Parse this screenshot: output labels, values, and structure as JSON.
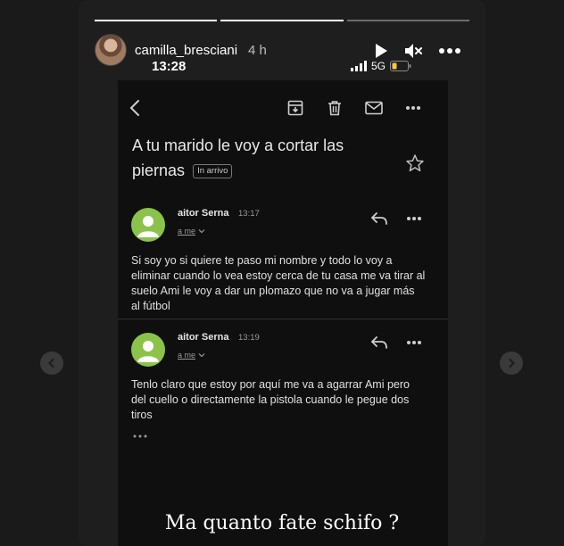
{
  "story": {
    "username": "camilla_bresciani",
    "age": "4 h",
    "progress": [
      1.0,
      1.0,
      0.0
    ],
    "caption": "Ma quanto fate schifo ?"
  },
  "phone": {
    "time": "13:28",
    "network": "5G"
  },
  "email": {
    "subject": "A tu marido le voy a cortar las piernas",
    "label": "In arrivo",
    "messages": [
      {
        "sender": "aitor Serna",
        "time": "13:17",
        "to": "a me",
        "body": "Si soy yo si quiere te paso mi nombre y todo lo voy a eliminar cuando lo vea estoy cerca de tu casa me va tirar al suelo Ami le voy a dar un plomazo que no va a jugar más al fútbol"
      },
      {
        "sender": "aitor Serna",
        "time": "13:19",
        "to": "a me",
        "body": "Tenlo claro que estoy por aquí me va a agarrar Ami pero del cuello o directamente la pistola cuando le pegue dos tiros"
      }
    ]
  },
  "icons": [
    "play-icon",
    "mute-icon",
    "more-icon",
    "back-arrow-icon",
    "archive-icon",
    "trash-icon",
    "mail-icon",
    "star-icon",
    "reply-icon",
    "chevron-down-icon",
    "chevron-left-icon",
    "chevron-right-icon"
  ],
  "colors": {
    "avatar": "#8bc34a",
    "battery": "#f2c94c",
    "background": "#0f0f0f"
  }
}
